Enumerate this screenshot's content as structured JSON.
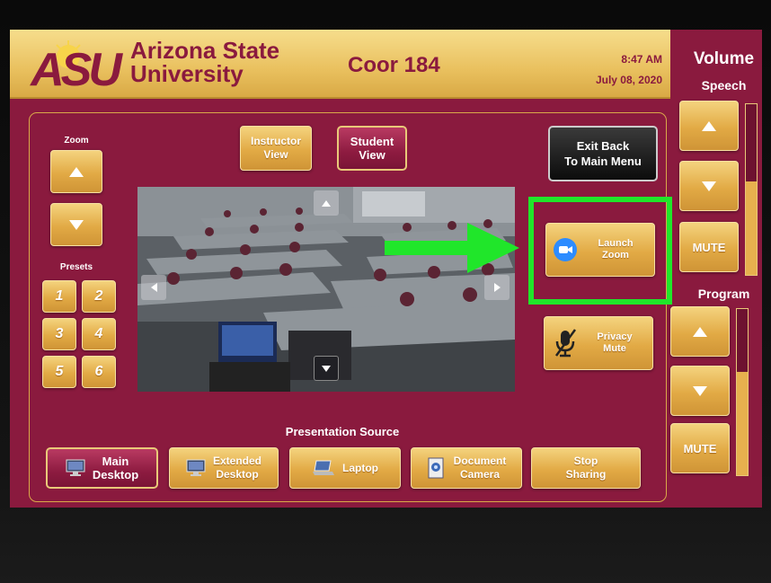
{
  "header": {
    "logo_letters": "ASU",
    "university": [
      "Arizona State",
      "University"
    ],
    "room": "Coor 184",
    "time": "8:47 AM",
    "date": "July 08, 2020"
  },
  "zoom": {
    "label": "Zoom"
  },
  "presets": {
    "label": "Presets",
    "items": [
      "1",
      "2",
      "3",
      "4",
      "5",
      "6"
    ]
  },
  "views": {
    "instructor": [
      "Instructor",
      "View"
    ],
    "student": [
      "Student",
      "View"
    ]
  },
  "exit_button": [
    "Exit Back",
    "To Main Menu"
  ],
  "launch_zoom": [
    "Launch",
    "Zoom"
  ],
  "privacy_mute": [
    "Privacy",
    "Mute"
  ],
  "presentation_source": {
    "label": "Presentation Source",
    "main_desktop": [
      "Main",
      "Desktop"
    ],
    "extended_desktop": [
      "Extended",
      "Desktop"
    ],
    "laptop": "Laptop",
    "document_camera": [
      "Document",
      "Camera"
    ],
    "stop_sharing": [
      "Stop",
      "Sharing"
    ]
  },
  "volume": {
    "title": "Volume",
    "speech": {
      "label": "Speech",
      "mute": "MUTE",
      "level": 0.55
    },
    "program": {
      "label": "Program",
      "mute": "MUTE",
      "level": 0.62
    }
  },
  "colors": {
    "maroon": "#8a1a3e",
    "gold": "#e2aa45",
    "highlight_green": "#20e62a",
    "zoom_blue": "#2d8cff"
  }
}
